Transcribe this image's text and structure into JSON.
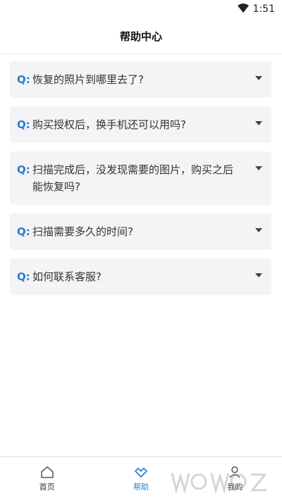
{
  "status_bar": {
    "time": "1:51",
    "wifi_icon": "wifi-icon"
  },
  "header": {
    "title": "帮助中心"
  },
  "faq": {
    "q_label": "Q:",
    "items": [
      {
        "question": "恢复的照片到哪里去了?"
      },
      {
        "question": "购买授权后，换手机还可以用吗?"
      },
      {
        "question": "扫描完成后，没发现需要的图片，购买之后能恢复吗?"
      },
      {
        "question": "扫描需要多久的时间?"
      },
      {
        "question": "如何联系客服?"
      }
    ]
  },
  "tabs": [
    {
      "label": "首页",
      "icon": "home-icon",
      "active": false
    },
    {
      "label": "帮助",
      "icon": "help-heart-icon",
      "active": true
    },
    {
      "label": "我的",
      "icon": "user-icon",
      "active": false
    }
  ],
  "colors": {
    "accent": "#2a7bd4",
    "card_bg": "#f4f4f6"
  }
}
